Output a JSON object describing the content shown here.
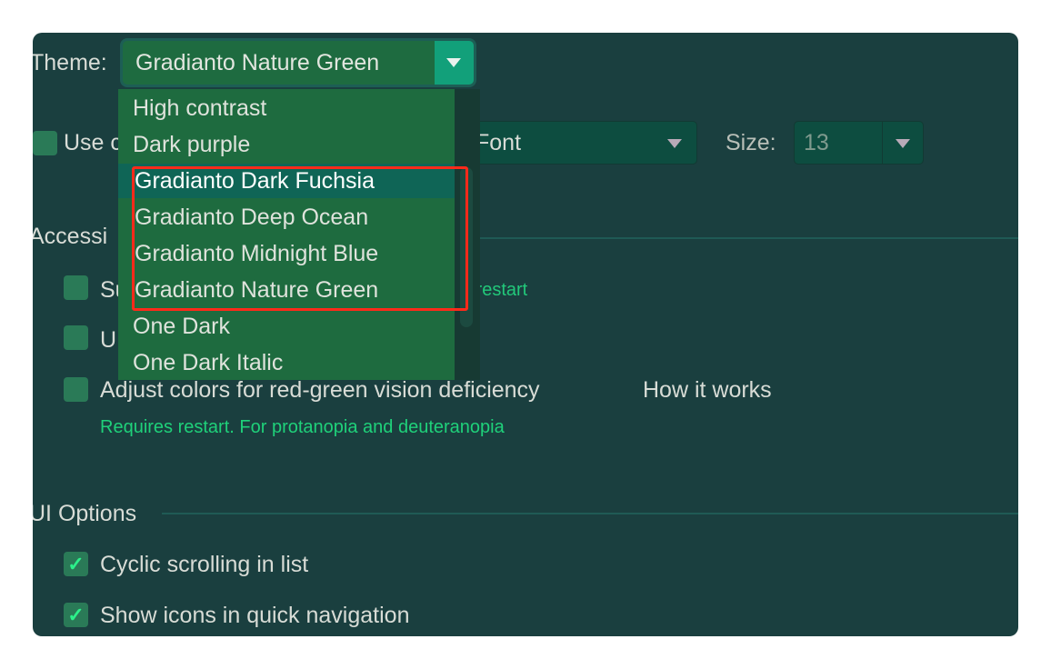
{
  "theme": {
    "label": "Theme:",
    "selected": "Gradianto Nature Green",
    "options": [
      "High contrast",
      "Dark purple",
      "Gradianto Dark Fuchsia",
      "Gradianto Deep Ocean",
      "Gradianto Midnight Blue",
      "Gradianto Nature Green",
      "One Dark",
      "One Dark Italic"
    ],
    "highlighted": "Gradianto Dark Fuchsia"
  },
  "font_row": {
    "checkbox_label_visible": "Use c",
    "font_value_visible": "Font",
    "size_label": "Size:",
    "size_value": "13"
  },
  "accessibility": {
    "header_visible": "Accessi",
    "option1_visible": "Su",
    "option1_note_visible": "s restart",
    "option2_visible": "U",
    "option3_label": "Adjust colors for red-green vision deficiency",
    "option3_link": "How it works",
    "option3_note": "Requires restart. For protanopia and deuteranopia"
  },
  "ui_options": {
    "header_visible": "UI Options",
    "items": [
      {
        "label": "Cyclic scrolling in list",
        "checked": true
      },
      {
        "label": "Show icons in quick navigation",
        "checked": true
      }
    ]
  },
  "colors": {
    "window_bg": "#1a3f3f",
    "popup_bg": "#1e6b3f",
    "selected_row": "#0f6556",
    "accent": "#12a07a",
    "note_green": "#22c87a",
    "annotation_red": "#ff2a1a"
  },
  "icons": {
    "check": "✓"
  }
}
